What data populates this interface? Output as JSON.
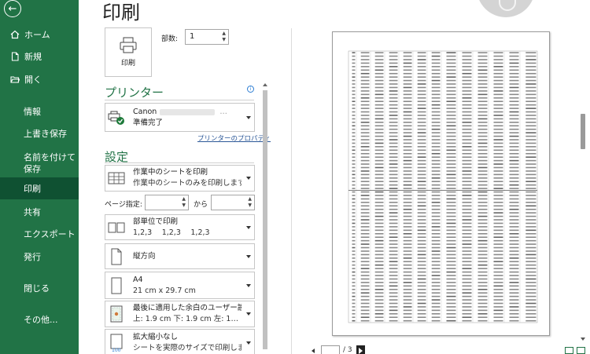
{
  "app": {
    "accent": "#217346",
    "active_nav": "#0f5132"
  },
  "sidebar": {
    "back_icon": "arrow-left-icon",
    "items": [
      {
        "label": "ホーム",
        "icon": "home-icon"
      },
      {
        "label": "新規",
        "icon": "new-file-icon"
      },
      {
        "label": "開く",
        "icon": "open-folder-icon"
      },
      {
        "label": "情報"
      },
      {
        "label": "上書き保存"
      },
      {
        "label": "名前を付けて保存"
      },
      {
        "label": "印刷",
        "active": true
      },
      {
        "label": "共有"
      },
      {
        "label": "エクスポート"
      },
      {
        "label": "発行"
      },
      {
        "label": "閉じる"
      },
      {
        "label": "その他..."
      }
    ]
  },
  "print": {
    "title": "印刷",
    "print_button": "印刷",
    "copies_label": "部数:",
    "copies_value": "1"
  },
  "printer": {
    "heading": "プリンター",
    "name": "Canon",
    "status": "準備完了",
    "properties_link": "プリンターのプロパティ"
  },
  "settings": {
    "heading": "設定",
    "scope": {
      "line1": "作業中のシートを印刷",
      "line2": "作業中のシートのみを印刷します"
    },
    "pages_label": "ページ指定:",
    "pages_to": "から",
    "collation": {
      "line1": "部単位で印刷",
      "line2": "1,2,3　 1,2,3　 1,2,3"
    },
    "orientation": {
      "line1": "縦方向"
    },
    "paper": {
      "line1": "A4",
      "line2": "21 cm x 29.7 cm"
    },
    "margins": {
      "line1": "最後に適用した余白のユーザー設定",
      "line2": "上: 1.9 cm 下: 1.9 cm 左: 1…"
    },
    "scaling": {
      "line1": "拡大縮小なし",
      "line2": "シートを実際のサイズで印刷します"
    }
  },
  "preview": {
    "page_current": "",
    "page_total_label": "/ 3"
  }
}
